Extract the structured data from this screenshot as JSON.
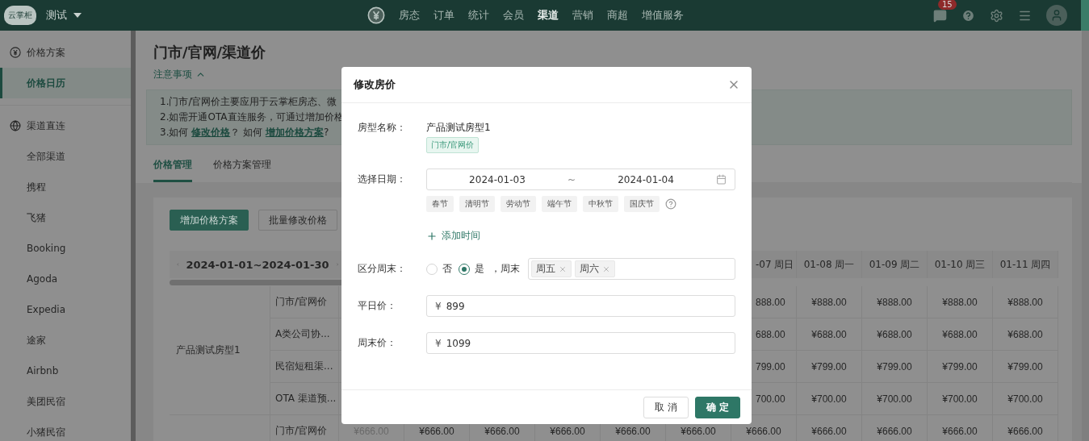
{
  "nav": {
    "logo": "云掌柜",
    "workspace": "测试",
    "items": [
      {
        "label": "房态",
        "selected": false
      },
      {
        "label": "订单",
        "selected": false
      },
      {
        "label": "统计",
        "selected": false
      },
      {
        "label": "会员",
        "selected": false
      },
      {
        "label": "渠道",
        "selected": true
      },
      {
        "label": "营销",
        "selected": false
      },
      {
        "label": "商超",
        "selected": false
      },
      {
        "label": "增值服务",
        "selected": false
      }
    ],
    "message_count": "15"
  },
  "sidebar": {
    "sections": [
      {
        "title": "价格方案",
        "items": [
          {
            "label": "价格日历",
            "selected": true
          }
        ]
      },
      {
        "title": "渠道直连",
        "items": [
          {
            "label": "全部渠道",
            "selected": false
          },
          {
            "label": "携程",
            "selected": false
          },
          {
            "label": "飞猪",
            "selected": false
          },
          {
            "label": "Booking",
            "selected": false
          },
          {
            "label": "Agoda",
            "selected": false
          },
          {
            "label": "Expedia",
            "selected": false
          },
          {
            "label": "途家",
            "selected": false
          },
          {
            "label": "Airbnb",
            "selected": false
          },
          {
            "label": "美团民宿",
            "selected": false
          },
          {
            "label": "小猪民宿",
            "selected": false
          }
        ]
      }
    ]
  },
  "page": {
    "title": "门市/官网/渠道价",
    "notice_toggle": "注意事项",
    "notice_expanded": true,
    "notices": [
      [
        {
          "text": "1.门市/官网价主要应用于云掌柜房态、微",
          "link": false
        }
      ],
      [
        {
          "text": "2.如需开通OTA直连服务，可通过增加价格",
          "link": false
        }
      ],
      [
        {
          "text": "3.如何 ",
          "link": false
        },
        {
          "text": "修改价格",
          "link": true
        },
        {
          "text": "？ 如何 ",
          "link": false
        },
        {
          "text": "增加价格方案",
          "link": true
        },
        {
          "text": "?",
          "link": false
        }
      ]
    ]
  },
  "tabs": [
    {
      "label": "价格管理",
      "selected": true
    },
    {
      "label": "价格方案管理",
      "selected": false
    }
  ],
  "toolbar": [
    {
      "label": "增加价格方案",
      "kind": "primary"
    },
    {
      "label": "批量修改价格",
      "kind": "default"
    }
  ],
  "table": {
    "date_range": "2024-01-01~2024-01-30",
    "date_headers": [
      "-07 周日",
      "01-08 周一",
      "01-09 周二",
      "01-10 周三",
      "01-11 周四"
    ],
    "groups": [
      {
        "room": "产品测试房型1",
        "rows": [
          {
            "channel": "门市/官网价",
            "cells": [
              {
                "text": "888.00",
                "disabled": false
              },
              {
                "text": "¥888.00",
                "disabled": false
              },
              {
                "text": "¥888.00",
                "disabled": false
              },
              {
                "text": "¥888.00",
                "disabled": false
              },
              {
                "text": "¥888.00",
                "disabled": false
              }
            ]
          },
          {
            "channel": "A类公司协...",
            "cells": [
              {
                "text": "688.00",
                "disabled": false
              },
              {
                "text": "¥688.00",
                "disabled": false
              },
              {
                "text": "¥688.00",
                "disabled": false
              },
              {
                "text": "¥688.00",
                "disabled": false
              },
              {
                "text": "¥688.00",
                "disabled": false
              }
            ]
          },
          {
            "channel": "民宿短租渠...",
            "cells": [
              {
                "text": "799.00",
                "disabled": false
              },
              {
                "text": "¥799.00",
                "disabled": false
              },
              {
                "text": "¥799.00",
                "disabled": false
              },
              {
                "text": "¥799.00",
                "disabled": false
              },
              {
                "text": "¥799.00",
                "disabled": false
              }
            ]
          },
          {
            "channel": "OTA 渠道预...",
            "cells": [
              {
                "text": "700.00",
                "disabled": false
              },
              {
                "text": "¥700.00",
                "disabled": false
              },
              {
                "text": "¥700.00",
                "disabled": false
              },
              {
                "text": "¥700.00",
                "disabled": false
              },
              {
                "text": "¥700.00",
                "disabled": false
              }
            ]
          }
        ]
      },
      {
        "rows": [
          {
            "channel": "门市/官网价",
            "cells": [
              {
                "text": "¥666.00",
                "disabled": true
              },
              {
                "text": "¥666.00",
                "disabled": false
              },
              {
                "text": "¥666.00",
                "disabled": false
              },
              {
                "text": "¥666.00",
                "disabled": false
              },
              {
                "text": "¥666.00",
                "disabled": false
              },
              {
                "text": "¥666.00",
                "disabled": false
              },
              {
                "text": "¥666.00",
                "disabled": false
              },
              {
                "text": "¥666.00",
                "disabled": false
              },
              {
                "text": "¥666.00",
                "disabled": false
              },
              {
                "text": "¥666.00",
                "disabled": false
              },
              {
                "text": "¥666.00",
                "disabled": false
              }
            ]
          }
        ]
      }
    ]
  },
  "dialog": {
    "title": "修改房价",
    "fields": [
      {
        "kind": "room",
        "label": "房型名称：",
        "value": "产品测试房型1",
        "tag": "门市/官网价"
      },
      {
        "kind": "dates",
        "label": "选择日期：",
        "start": "2024-01-03",
        "separator": "~",
        "end": "2024-01-04",
        "holidays": [
          "春节",
          "清明节",
          "劳动节",
          "端午节",
          "中秋节",
          "国庆节"
        ],
        "add_label": "添加时间"
      },
      {
        "kind": "weekend",
        "label": "区分周末：",
        "options": [
          {
            "label": "否",
            "selected": false
          },
          {
            "label": "是",
            "selected": true
          }
        ],
        "suffix": "，周末",
        "days": [
          "周五",
          "周六"
        ]
      },
      {
        "kind": "price",
        "label": "平日价：",
        "prefix": "¥",
        "value": "899"
      },
      {
        "kind": "price",
        "label": "周末价：",
        "prefix": "¥",
        "value": "1099"
      }
    ],
    "buttons": [
      {
        "label": "取 消",
        "kind": "default"
      },
      {
        "label": "确 定",
        "kind": "primary"
      }
    ]
  }
}
